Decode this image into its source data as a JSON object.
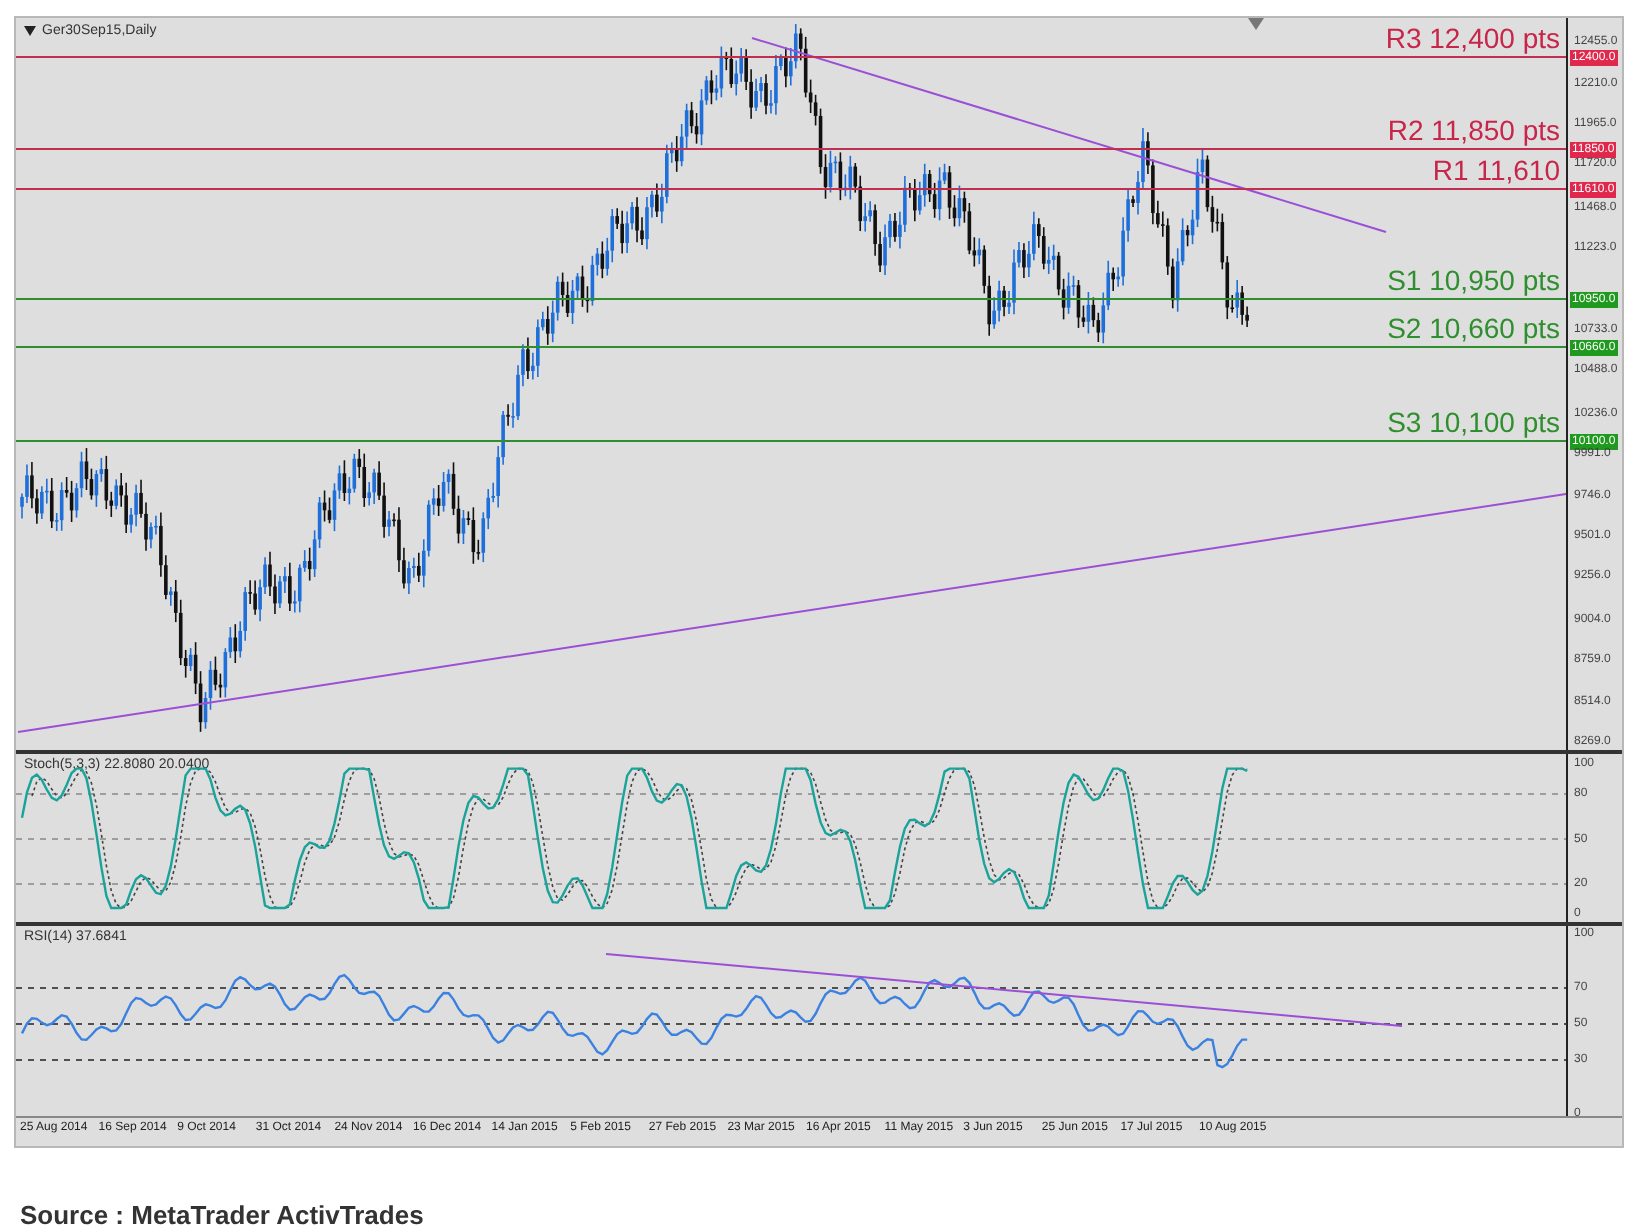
{
  "chart": {
    "title": "Ger30Sep15,Daily",
    "levels": [
      {
        "kind": "resistance",
        "label": "R3 12,400 pts",
        "price_tag": "12400.0"
      },
      {
        "kind": "resistance",
        "label": "R2 11,850 pts",
        "price_tag": "11850.0"
      },
      {
        "kind": "resistance",
        "label": "R1 11,610",
        "price_tag": "11610.0"
      },
      {
        "kind": "support",
        "label": "S1 10,950 pts",
        "price_tag": "10950.0"
      },
      {
        "kind": "support",
        "label": "S2 10,660 pts",
        "price_tag": "10660.0"
      },
      {
        "kind": "support",
        "label": "S3 10,100 pts",
        "price_tag": "10100.0"
      }
    ],
    "price_ticks": [
      "12455.0",
      "12210.0",
      "11965.0",
      "11720.0",
      "11468.0",
      "11223.0",
      "10733.0",
      "10488.0",
      "10236.0",
      "9991.0",
      "9746.0",
      "9501.0",
      "9256.0",
      "9004.0",
      "8759.0",
      "8514.0",
      "8269.0"
    ]
  },
  "stochastic": {
    "title": "Stoch(5,3,3) 22.8080 20.0400",
    "ticks": [
      "100",
      "80",
      "50",
      "20",
      "0"
    ]
  },
  "rsi": {
    "title": "RSI(14) 37.6841",
    "ticks": [
      "100",
      "70",
      "50",
      "30",
      "0"
    ]
  },
  "dates": [
    "25 Aug 2014",
    "16 Sep 2014",
    "9 Oct 2014",
    "31 Oct 2014",
    "24 Nov 2014",
    "16 Dec 2014",
    "14 Jan 2015",
    "5 Feb 2015",
    "27 Feb 2015",
    "23 Mar 2015",
    "16 Apr 2015",
    "11 May 2015",
    "3 Jun 2015",
    "25 Jun 2015",
    "17 Jul 2015",
    "10 Aug 2015"
  ],
  "caption": "Source : MetaTrader ActivTrades"
}
